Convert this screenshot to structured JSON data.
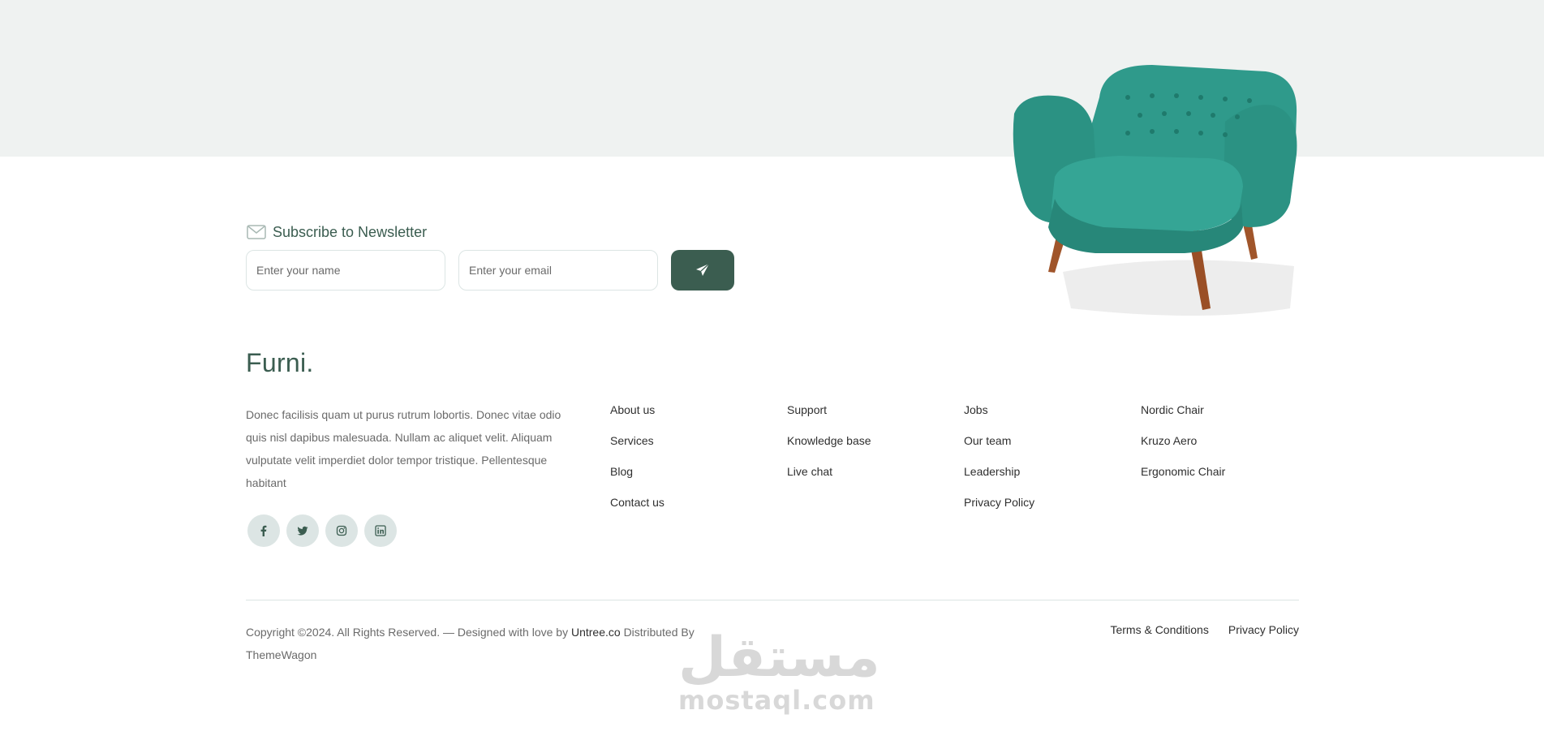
{
  "colors": {
    "primary": "#3b5d50",
    "band": "#eff2f1",
    "chair": "#2f9a8b",
    "muted": "#6a6a6a",
    "social_bg": "#dce5e4"
  },
  "newsletter": {
    "icon": "envelope-icon",
    "title": "Subscribe to Newsletter",
    "name_placeholder": "Enter your name",
    "email_placeholder": "Enter your email",
    "send_icon": "paper-plane-icon"
  },
  "brand": "Furni.",
  "about": "Donec facilisis quam ut purus rutrum lobortis. Donec vitae odio quis nisl dapibus malesuada. Nullam ac aliquet velit. Aliquam vulputate velit imperdiet dolor tempor tristique. Pellentesque habitant",
  "socials": [
    "facebook-icon",
    "twitter-icon",
    "instagram-icon",
    "linkedin-icon"
  ],
  "links": {
    "col1": [
      "About us",
      "Services",
      "Blog",
      "Contact us"
    ],
    "col2": [
      "Support",
      "Knowledge base",
      "Live chat"
    ],
    "col3": [
      "Jobs",
      "Our team",
      "Leadership",
      "Privacy Policy"
    ],
    "col4": [
      "Nordic Chair",
      "Kruzo Aero",
      "Ergonomic Chair"
    ]
  },
  "copyright": {
    "prefix": "Copyright ©2024. All Rights Reserved. — Designed with love by",
    "link1": "Untree.co",
    "middle": "Distributed By",
    "link2": "ThemeWagon"
  },
  "legal": [
    "Terms & Conditions",
    "Privacy Policy"
  ],
  "watermark": {
    "arabic": "مستقل",
    "latin": "mostaql.com"
  }
}
